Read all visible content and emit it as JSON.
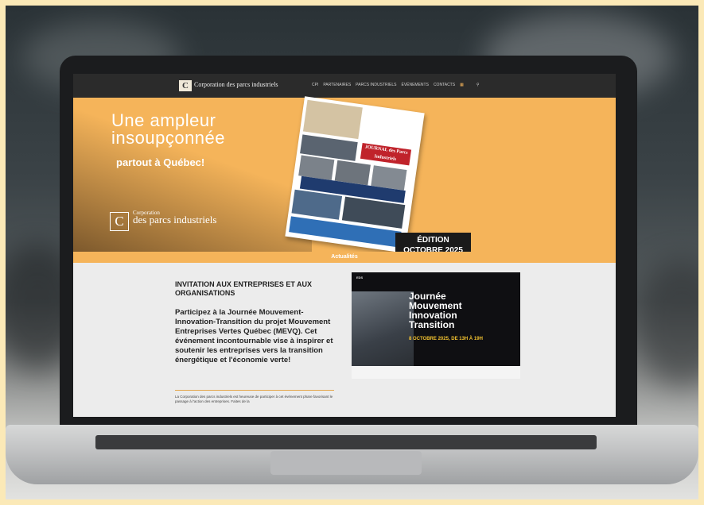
{
  "nav": {
    "logo_letter": "C",
    "logo_text": "Corporation des parcs industriels",
    "items": [
      "CPI",
      "PARTENAIRES",
      "PARCS INDUSTRIELS",
      "ÉVÉNEMENTS",
      "CONTACTS"
    ]
  },
  "hero": {
    "headline_line1": "Une ampleur",
    "headline_line2": "insoupçonnée",
    "tagline": "partout à Québec!",
    "brand_letter": "C",
    "brand_small": "Corporation",
    "brand_text": "des parcs industriels",
    "magazine_title": "JOURNAL des Parcs Industriels",
    "edition_line1": "ÉDITION",
    "edition_line2": "OCTOBRE 2025"
  },
  "section_label": "Actualités",
  "article": {
    "title": "INVITATION AUX ENTREPRISES ET AUX ORGANISATIONS",
    "body": "Participez à la Journée Mouvement-Innovation-Transition du projet Mouvement Entreprises Vertes Québec (MEVQ). Cet événement incontournable vise à inspirer et soutenir les entreprises vers la transition énergétique et l'économie verte!",
    "excerpt": "La Corporation des parcs industriels est heureuse de participer à cet événement phare favorisant le passage à l'action des entreprises. Faites de la"
  },
  "event_card": {
    "top": "EDS",
    "title_line1": "Journée",
    "title_line2": "Mouvement",
    "title_line3": "Innovation",
    "title_line4": "Transition",
    "date": "8 OCTOBRE 2025, DE 13H À 19H"
  }
}
